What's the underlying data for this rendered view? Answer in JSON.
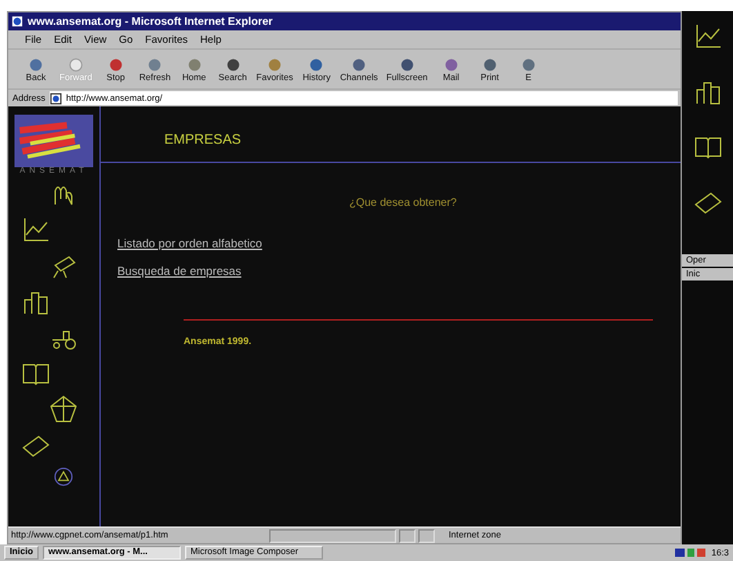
{
  "window": {
    "title": "www.ansemat.org - Microsoft Internet Explorer"
  },
  "menu": [
    "File",
    "Edit",
    "View",
    "Go",
    "Favorites",
    "Help"
  ],
  "toolbar": [
    {
      "label": "Back",
      "disabled": false
    },
    {
      "label": "Forward",
      "disabled": true
    },
    {
      "label": "Stop",
      "disabled": false
    },
    {
      "label": "Refresh",
      "disabled": false
    },
    {
      "label": "Home",
      "disabled": false
    },
    {
      "label": "Search",
      "disabled": false
    },
    {
      "label": "Favorites",
      "disabled": false
    },
    {
      "label": "History",
      "disabled": false
    },
    {
      "label": "Channels",
      "disabled": false
    },
    {
      "label": "Fullscreen",
      "disabled": false
    },
    {
      "label": "Mail",
      "disabled": false
    },
    {
      "label": "Print",
      "disabled": false
    },
    {
      "label": "E",
      "disabled": false
    }
  ],
  "address": {
    "label": "Address",
    "value": "http://www.ansemat.org/"
  },
  "page": {
    "logo_text": "ANSEMAT",
    "heading": "EMPRESAS",
    "question": "¿Que desea obtener?",
    "links": [
      "Listado por orden alfabetico",
      "Busqueda de empresas"
    ],
    "footer": "Ansemat 1999."
  },
  "status_bar": {
    "url": "http://www.cgpnet.com/ansemat/p1.htm",
    "zone": "Internet zone"
  },
  "side_window": {
    "items": [
      "Oper",
      "Inic"
    ]
  },
  "taskbar": {
    "start": "Inicio",
    "tasks": [
      {
        "label": "www.ansemat.org - M...",
        "selected": true
      },
      {
        "label": "Microsoft Image Composer",
        "selected": false
      }
    ],
    "clock": "16:3"
  }
}
